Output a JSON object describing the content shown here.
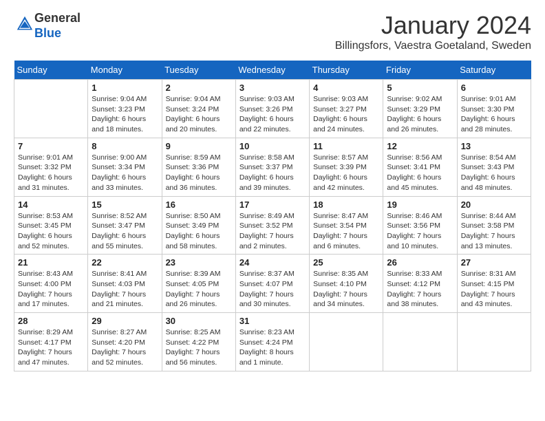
{
  "header": {
    "logo_general": "General",
    "logo_blue": "Blue",
    "month_title": "January 2024",
    "location": "Billingsfors, Vaestra Goetaland, Sweden"
  },
  "days_of_week": [
    "Sunday",
    "Monday",
    "Tuesday",
    "Wednesday",
    "Thursday",
    "Friday",
    "Saturday"
  ],
  "weeks": [
    [
      {
        "day": "",
        "info": ""
      },
      {
        "day": "1",
        "info": "Sunrise: 9:04 AM\nSunset: 3:23 PM\nDaylight: 6 hours\nand 18 minutes."
      },
      {
        "day": "2",
        "info": "Sunrise: 9:04 AM\nSunset: 3:24 PM\nDaylight: 6 hours\nand 20 minutes."
      },
      {
        "day": "3",
        "info": "Sunrise: 9:03 AM\nSunset: 3:26 PM\nDaylight: 6 hours\nand 22 minutes."
      },
      {
        "day": "4",
        "info": "Sunrise: 9:03 AM\nSunset: 3:27 PM\nDaylight: 6 hours\nand 24 minutes."
      },
      {
        "day": "5",
        "info": "Sunrise: 9:02 AM\nSunset: 3:29 PM\nDaylight: 6 hours\nand 26 minutes."
      },
      {
        "day": "6",
        "info": "Sunrise: 9:01 AM\nSunset: 3:30 PM\nDaylight: 6 hours\nand 28 minutes."
      }
    ],
    [
      {
        "day": "7",
        "info": "Sunrise: 9:01 AM\nSunset: 3:32 PM\nDaylight: 6 hours\nand 31 minutes."
      },
      {
        "day": "8",
        "info": "Sunrise: 9:00 AM\nSunset: 3:34 PM\nDaylight: 6 hours\nand 33 minutes."
      },
      {
        "day": "9",
        "info": "Sunrise: 8:59 AM\nSunset: 3:36 PM\nDaylight: 6 hours\nand 36 minutes."
      },
      {
        "day": "10",
        "info": "Sunrise: 8:58 AM\nSunset: 3:37 PM\nDaylight: 6 hours\nand 39 minutes."
      },
      {
        "day": "11",
        "info": "Sunrise: 8:57 AM\nSunset: 3:39 PM\nDaylight: 6 hours\nand 42 minutes."
      },
      {
        "day": "12",
        "info": "Sunrise: 8:56 AM\nSunset: 3:41 PM\nDaylight: 6 hours\nand 45 minutes."
      },
      {
        "day": "13",
        "info": "Sunrise: 8:54 AM\nSunset: 3:43 PM\nDaylight: 6 hours\nand 48 minutes."
      }
    ],
    [
      {
        "day": "14",
        "info": "Sunrise: 8:53 AM\nSunset: 3:45 PM\nDaylight: 6 hours\nand 52 minutes."
      },
      {
        "day": "15",
        "info": "Sunrise: 8:52 AM\nSunset: 3:47 PM\nDaylight: 6 hours\nand 55 minutes."
      },
      {
        "day": "16",
        "info": "Sunrise: 8:50 AM\nSunset: 3:49 PM\nDaylight: 6 hours\nand 58 minutes."
      },
      {
        "day": "17",
        "info": "Sunrise: 8:49 AM\nSunset: 3:52 PM\nDaylight: 7 hours\nand 2 minutes."
      },
      {
        "day": "18",
        "info": "Sunrise: 8:47 AM\nSunset: 3:54 PM\nDaylight: 7 hours\nand 6 minutes."
      },
      {
        "day": "19",
        "info": "Sunrise: 8:46 AM\nSunset: 3:56 PM\nDaylight: 7 hours\nand 10 minutes."
      },
      {
        "day": "20",
        "info": "Sunrise: 8:44 AM\nSunset: 3:58 PM\nDaylight: 7 hours\nand 13 minutes."
      }
    ],
    [
      {
        "day": "21",
        "info": "Sunrise: 8:43 AM\nSunset: 4:00 PM\nDaylight: 7 hours\nand 17 minutes."
      },
      {
        "day": "22",
        "info": "Sunrise: 8:41 AM\nSunset: 4:03 PM\nDaylight: 7 hours\nand 21 minutes."
      },
      {
        "day": "23",
        "info": "Sunrise: 8:39 AM\nSunset: 4:05 PM\nDaylight: 7 hours\nand 26 minutes."
      },
      {
        "day": "24",
        "info": "Sunrise: 8:37 AM\nSunset: 4:07 PM\nDaylight: 7 hours\nand 30 minutes."
      },
      {
        "day": "25",
        "info": "Sunrise: 8:35 AM\nSunset: 4:10 PM\nDaylight: 7 hours\nand 34 minutes."
      },
      {
        "day": "26",
        "info": "Sunrise: 8:33 AM\nSunset: 4:12 PM\nDaylight: 7 hours\nand 38 minutes."
      },
      {
        "day": "27",
        "info": "Sunrise: 8:31 AM\nSunset: 4:15 PM\nDaylight: 7 hours\nand 43 minutes."
      }
    ],
    [
      {
        "day": "28",
        "info": "Sunrise: 8:29 AM\nSunset: 4:17 PM\nDaylight: 7 hours\nand 47 minutes."
      },
      {
        "day": "29",
        "info": "Sunrise: 8:27 AM\nSunset: 4:20 PM\nDaylight: 7 hours\nand 52 minutes."
      },
      {
        "day": "30",
        "info": "Sunrise: 8:25 AM\nSunset: 4:22 PM\nDaylight: 7 hours\nand 56 minutes."
      },
      {
        "day": "31",
        "info": "Sunrise: 8:23 AM\nSunset: 4:24 PM\nDaylight: 8 hours\nand 1 minute."
      },
      {
        "day": "",
        "info": ""
      },
      {
        "day": "",
        "info": ""
      },
      {
        "day": "",
        "info": ""
      }
    ]
  ]
}
